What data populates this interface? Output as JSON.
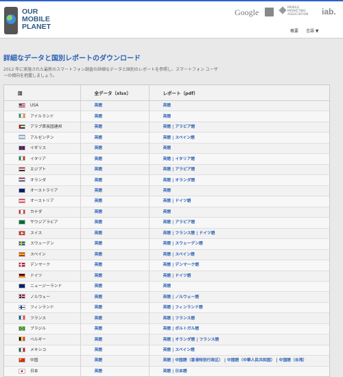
{
  "header": {
    "logo_lines": [
      "OUR",
      "MOBILE",
      "PLANET"
    ],
    "partners": {
      "google": "Google",
      "mma": "MOBILE MARKETING ASSOCIATION",
      "iab": "iab."
    },
    "nav": {
      "about": "概要",
      "language": "言語 ▼"
    }
  },
  "page": {
    "title": "詳細なデータと国別レポートのダウンロード",
    "intro": "2012 年に実施された最新のスマートフォン調査の詳細なデータと国別のレポートを参照し、スマートフォン ユーザーの傾向を把握しましょう。"
  },
  "table": {
    "headers": {
      "country": "国",
      "xlsx": "全データ（xlsx）",
      "pdf": "レポート（pdf）"
    },
    "rows": [
      {
        "country": "USA",
        "flag": "us",
        "xlsx": "英語",
        "pdf": [
          "英語"
        ]
      },
      {
        "country": "アイルランド",
        "flag": "ie",
        "xlsx": "英語",
        "pdf": [
          "英語"
        ]
      },
      {
        "country": "アラブ首長国連邦",
        "flag": "ae",
        "xlsx": "英語",
        "pdf": [
          "英語",
          "アラビア語"
        ]
      },
      {
        "country": "アルゼンチン",
        "flag": "ar",
        "xlsx": "英語",
        "pdf": [
          "英語",
          "スペイン語"
        ]
      },
      {
        "country": "イギリス",
        "flag": "gb",
        "xlsx": "英語",
        "pdf": [
          "英語"
        ]
      },
      {
        "country": "イタリア",
        "flag": "it",
        "xlsx": "英語",
        "pdf": [
          "英語",
          "イタリア語"
        ]
      },
      {
        "country": "エジプト",
        "flag": "eg",
        "xlsx": "英語",
        "pdf": [
          "英語",
          "アラビア語"
        ]
      },
      {
        "country": "オランダ",
        "flag": "nl",
        "xlsx": "英語",
        "pdf": [
          "英語",
          "オランダ語"
        ]
      },
      {
        "country": "オーストラリア",
        "flag": "au",
        "xlsx": "英語",
        "pdf": [
          "英語"
        ]
      },
      {
        "country": "オーストリア",
        "flag": "at",
        "xlsx": "英語",
        "pdf": [
          "英語",
          "ドイツ語"
        ]
      },
      {
        "country": "カナダ",
        "flag": "ca",
        "xlsx": "英語",
        "pdf": [
          "英語"
        ]
      },
      {
        "country": "サウジアラビア",
        "flag": "sa",
        "xlsx": "英語",
        "pdf": [
          "英語",
          "アラビア語"
        ]
      },
      {
        "country": "スイス",
        "flag": "ch",
        "xlsx": "英語",
        "pdf": [
          "英語",
          "フランス語",
          "ドイツ語"
        ]
      },
      {
        "country": "スウェーデン",
        "flag": "se",
        "xlsx": "英語",
        "pdf": [
          "英語",
          "スウェーデン語"
        ]
      },
      {
        "country": "スペイン",
        "flag": "es",
        "xlsx": "英語",
        "pdf": [
          "英語",
          "スペイン語"
        ]
      },
      {
        "country": "デンマーク",
        "flag": "dk",
        "xlsx": "英語",
        "pdf": [
          "英語",
          "デンマーク語"
        ]
      },
      {
        "country": "ドイツ",
        "flag": "de",
        "xlsx": "英語",
        "pdf": [
          "英語",
          "ドイツ語"
        ]
      },
      {
        "country": "ニュージーランド",
        "flag": "nz",
        "xlsx": "英語",
        "pdf": [
          "英語"
        ]
      },
      {
        "country": "ノルウェー",
        "flag": "no",
        "xlsx": "英語",
        "pdf": [
          "英語",
          "ノルウェー語"
        ]
      },
      {
        "country": "フィンランド",
        "flag": "fi",
        "xlsx": "英語",
        "pdf": [
          "英語",
          "フィンランド語"
        ]
      },
      {
        "country": "フランス",
        "flag": "fr",
        "xlsx": "英語",
        "pdf": [
          "英語",
          "フランス語"
        ]
      },
      {
        "country": "ブラジル",
        "flag": "br",
        "xlsx": "英語",
        "pdf": [
          "英語",
          "ポルトガル語"
        ]
      },
      {
        "country": "ベルギー",
        "flag": "be",
        "xlsx": "英語",
        "pdf": [
          "英語",
          "オランダ語",
          "フランス語"
        ]
      },
      {
        "country": "メキシコ",
        "flag": "mx",
        "xlsx": "英語",
        "pdf": [
          "英語",
          "スペイン語"
        ]
      },
      {
        "country": "中国",
        "flag": "cn",
        "xlsx": "英語",
        "pdf": [
          "英語",
          "中国語（香港特別行政区）",
          "中国語（中華人民共和国）",
          "中国語（台湾）"
        ]
      },
      {
        "country": "日本",
        "flag": "jp",
        "xlsx": "英語",
        "pdf": [
          "英語",
          "日本語"
        ]
      }
    ]
  },
  "colors": {
    "link": "#2b61b5",
    "topbar": "#2d63c8",
    "page_bg": "#e9e9e9"
  }
}
